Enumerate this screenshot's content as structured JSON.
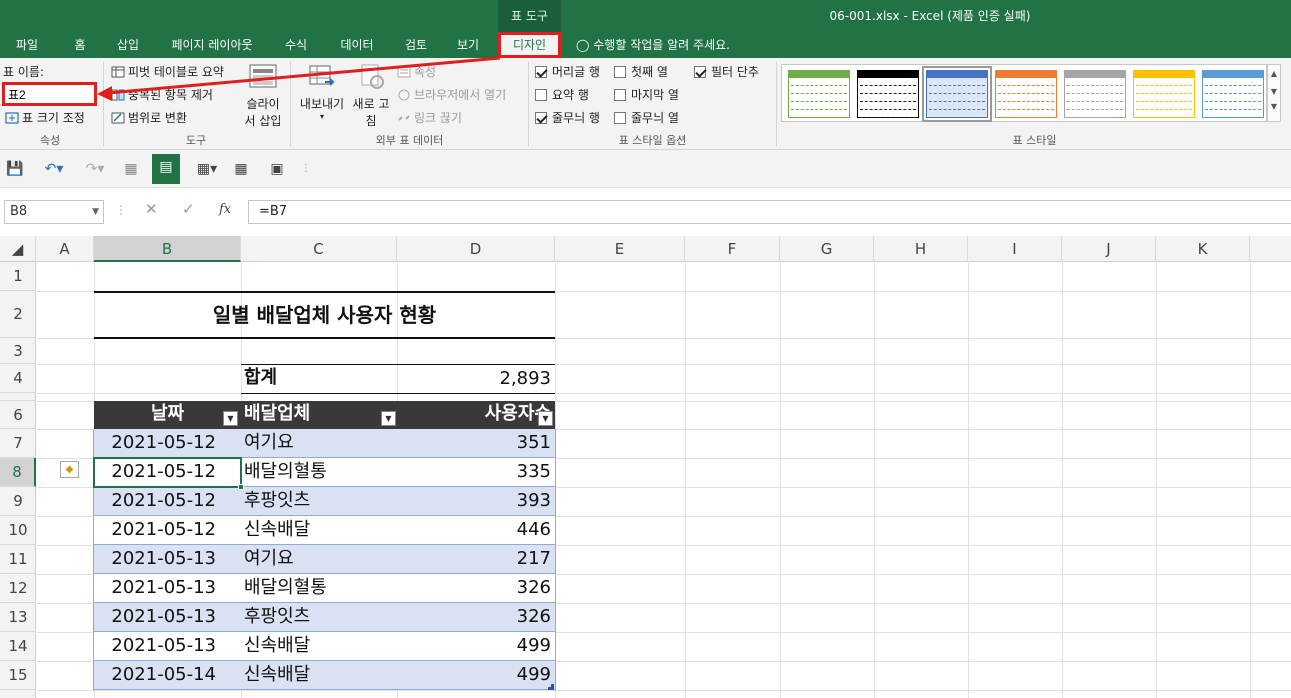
{
  "titlebar": {
    "context_label": "표 도구",
    "window_title": "06-001.xlsx - Excel (제품 인증 실패)"
  },
  "tabs": [
    "파일",
    "홈",
    "삽입",
    "페이지 레이아웃",
    "수식",
    "데이터",
    "검토",
    "보기",
    "디자인"
  ],
  "tell_me": "수행할 작업을 알려 주세요.",
  "ribbon": {
    "properties": {
      "table_name_label": "표 이름:",
      "table_name_value": "표2",
      "resize_label": "표 크기 조정",
      "group_label": "속성"
    },
    "tools": {
      "pivot_label": "피벗 테이블로 요약",
      "remove_dup_label": "중복된 항목 제거",
      "convert_label": "범위로 변환",
      "slicer_label_1": "슬라이",
      "slicer_label_2": "서 삽입",
      "group_label": "도구"
    },
    "external": {
      "export_label": "내보내기",
      "refresh_label_1": "새로 고",
      "refresh_label_2": "침",
      "properties_label": "속성",
      "open_browser_label": "브라우저에서 열기",
      "unlink_label": "링크 끊기",
      "group_label": "외부 표 데이터"
    },
    "style_options": {
      "header_row": "머리글 행",
      "total_row": "요약 행",
      "banded_rows": "줄무늬 행",
      "first_col": "첫째 열",
      "last_col": "마지막 열",
      "banded_cols": "줄무늬 열",
      "filter_button": "필터 단추",
      "header_row_checked": true,
      "total_row_checked": false,
      "banded_rows_checked": true,
      "first_col_checked": false,
      "last_col_checked": false,
      "banded_cols_checked": false,
      "filter_button_checked": true,
      "group_label": "표 스타일 옵션"
    },
    "table_styles": {
      "group_label": "표 스타일",
      "swatch_colors": [
        "#70ad47",
        "#000000",
        "#4472c4",
        "#ed7d31",
        "#a5a5a5",
        "#ffc000",
        "#5b9bd5"
      ]
    }
  },
  "formula_bar": {
    "name_box": "B8",
    "formula": "=B7",
    "fx_label": "fx"
  },
  "columns": [
    "A",
    "B",
    "C",
    "D",
    "E",
    "F",
    "G",
    "H",
    "I",
    "J",
    "K"
  ],
  "rows": [
    "1",
    "2",
    "3",
    "4",
    "6",
    "7",
    "8",
    "9",
    "10",
    "11",
    "12",
    "13",
    "14",
    "15"
  ],
  "sheet": {
    "title": "일별 배달업체 사용자 현황",
    "total_label": "합계",
    "total_value": "2,893",
    "headers": [
      "날짜",
      "배달업체",
      "사용자수"
    ],
    "data": [
      [
        "2021-05-12",
        "여기요",
        "351"
      ],
      [
        "2021-05-12",
        "배달의혈통",
        "335"
      ],
      [
        "2021-05-12",
        "후팡잇츠",
        "393"
      ],
      [
        "2021-05-12",
        "신속배달",
        "446"
      ],
      [
        "2021-05-13",
        "여기요",
        "217"
      ],
      [
        "2021-05-13",
        "배달의혈통",
        "326"
      ],
      [
        "2021-05-13",
        "후팡잇츠",
        "326"
      ],
      [
        "2021-05-13",
        "신속배달",
        "499"
      ],
      [
        "2021-05-14",
        "신속배달",
        "499"
      ]
    ]
  },
  "colors": {
    "excel_green": "#217346",
    "header_dark": "#3a3838",
    "band_blue": "#d9e1f2",
    "highlight_red": "#e01e1e"
  }
}
